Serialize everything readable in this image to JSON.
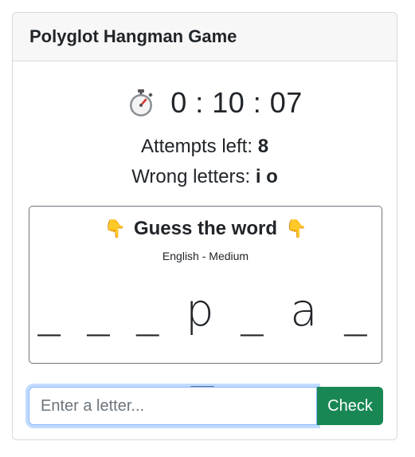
{
  "game": {
    "title": "Polyglot Hangman Game",
    "timer": "0 : 10 : 07",
    "attempts_label": "Attempts left:",
    "attempts_value": "8",
    "wrong_label": "Wrong letters:",
    "wrong_value": "i o"
  },
  "word_panel": {
    "heading": "Guess the word",
    "left_icon": "pointing-down-icon",
    "right_icon": "pointing-down-icon",
    "subtitle": "English - Medium",
    "masked_word": "_ _ _ p _ a _ _"
  },
  "input": {
    "placeholder": "Enter a letter...",
    "value": "",
    "check_label": "Check"
  },
  "colors": {
    "accent_green": "#198754",
    "focus_blue": "#86b7fe",
    "icon_yellow": "#f2b200"
  },
  "icons": {
    "timer": "stopwatch-icon"
  }
}
